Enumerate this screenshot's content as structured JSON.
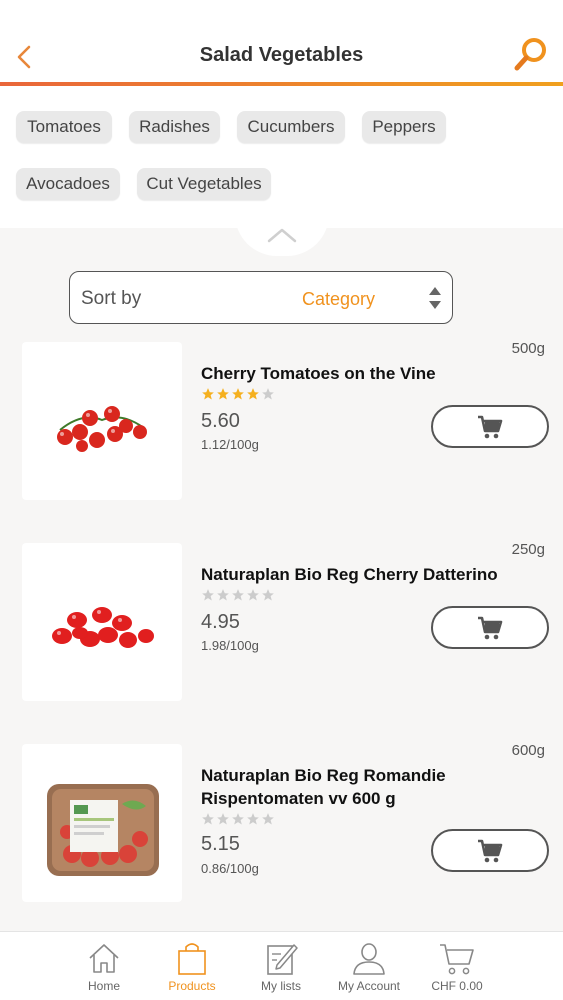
{
  "header": {
    "title": "Salad Vegetables"
  },
  "chips": [
    "Tomatoes",
    "Radishes",
    "Cucumbers",
    "Peppers",
    "Avocadoes",
    "Cut Vegetables"
  ],
  "sort": {
    "label": "Sort by",
    "value": "Category"
  },
  "products": [
    {
      "name": "Cherry Tomatoes on the Vine",
      "weight": "500g",
      "rating": 4,
      "price": "5.60",
      "unit_price": "1.12/100g"
    },
    {
      "name": "Naturaplan Bio Reg Cherry Datterino",
      "weight": "250g",
      "rating": 0,
      "price": "4.95",
      "unit_price": "1.98/100g"
    },
    {
      "name": "Naturaplan Bio Reg Romandie Rispentomaten vv 600 g",
      "weight": "600g",
      "rating": 0,
      "price": "5.15",
      "unit_price": "0.86/100g"
    }
  ],
  "tabbar": {
    "home": "Home",
    "products": "Products",
    "my_lists": "My lists",
    "my_account": "My Account",
    "cart_total": "CHF 0.00"
  },
  "colors": {
    "accent": "#f0921e",
    "rule_start": "#e9663a",
    "rule_end": "#f0a01e",
    "star_on": "#f5b01e",
    "star_off": "#cccccc"
  },
  "icons": [
    "chevron-left-icon",
    "search-icon",
    "chevron-up-icon",
    "sort-arrows-icon",
    "cart-icon",
    "home-icon",
    "bag-icon",
    "list-icon",
    "account-icon",
    "cart-icon"
  ]
}
